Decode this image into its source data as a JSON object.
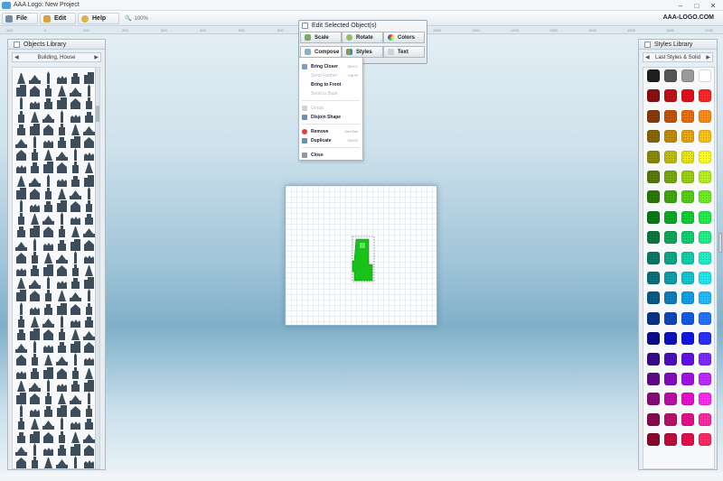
{
  "window": {
    "title": "AAA Logo: New Project"
  },
  "menu": {
    "file_label": "File",
    "edit_label": "Edit",
    "help_label": "Help",
    "zoom_value": "100%",
    "brand": "AAA-LOGO.COM"
  },
  "ruler_ticks": [
    "-100",
    "0",
    "100",
    "200",
    "300",
    "400",
    "500",
    "600",
    "700",
    "800",
    "900",
    "1000",
    "1100",
    "1200",
    "1300",
    "1400",
    "1500",
    "1600",
    "1700"
  ],
  "objects_library": {
    "title": "Objects Library",
    "category": "Building, House",
    "icon_names": [
      "tower-icon",
      "lighthouse-icon",
      "crane-icon",
      "building-icon",
      "factory-icon",
      "house-icon",
      "church-icon",
      "castle-icon",
      "temple-icon",
      "skyscraper-icon",
      "monument-icon",
      "tree-house-icon",
      "barn-icon",
      "bridge-icon",
      "pagoda-icon",
      "pyramid-icon"
    ]
  },
  "edit_panel": {
    "title": "Edit Selected Object(s)",
    "scale_label": "Scale",
    "rotate_label": "Rotate",
    "colors_label": "Colors",
    "compose_label": "Compose",
    "styles_label": "Styles",
    "text_label": "Text"
  },
  "compose_menu": {
    "bring_closer": "Bring Closer",
    "bring_closer_shortcut": "Ctrl+C",
    "send_farther": "Send Farther",
    "send_farther_shortcut": "Ctrl+F",
    "bring_to_front": "Bring to Front",
    "send_to_back": "Send to Back",
    "group": "Group",
    "disjoin_shape": "Disjoin Shape",
    "remove": "Remove",
    "remove_shortcut": "Ctrl+Del",
    "duplicate": "Duplicate",
    "duplicate_shortcut": "Ctrl+D",
    "close": "Close"
  },
  "styles_library": {
    "title": "Styles Library",
    "category": "Last Styles & Solid",
    "swatch_rows": [
      [
        "#1e1e1e",
        "#555555",
        "#9a9a9a",
        "#ffffff"
      ],
      [
        "#8b0f12",
        "#c01018",
        "#e0111a",
        "#ff2626"
      ],
      [
        "#8a3a08",
        "#c0560a",
        "#e8700c",
        "#ff8c1a"
      ],
      [
        "#8a6508",
        "#c08a0a",
        "#e6a80c",
        "#ffc21a"
      ],
      [
        "#8a8a0a",
        "#bdbd0e",
        "#e6e610",
        "#ffff22"
      ],
      [
        "#5a7a0a",
        "#7aa80e",
        "#9ad010",
        "#b8f020"
      ],
      [
        "#2a7a0a",
        "#3ea80e",
        "#54d010",
        "#6ef020"
      ],
      [
        "#0a7a18",
        "#0ea826",
        "#10d034",
        "#22f04a"
      ],
      [
        "#0a7a3e",
        "#0ea858",
        "#10d070",
        "#22f088"
      ],
      [
        "#0a7a62",
        "#0ea888",
        "#10d0aa",
        "#22f0c8"
      ],
      [
        "#0a727a",
        "#0ea0a8",
        "#10c8d0",
        "#22e8f0"
      ],
      [
        "#0a5a8a",
        "#0e7ebd",
        "#10a0e6",
        "#22bcff"
      ],
      [
        "#0a348a",
        "#0e48bd",
        "#105ce6",
        "#2274ff"
      ],
      [
        "#0a0e8a",
        "#0e12bd",
        "#1016e6",
        "#2a30ff"
      ],
      [
        "#360a8a",
        "#4a0ebd",
        "#5e10e6",
        "#7a2aff"
      ],
      [
        "#5e0a8a",
        "#820ebd",
        "#a410e6",
        "#c02aff"
      ],
      [
        "#8a0a7a",
        "#bd0ea8",
        "#e610d0",
        "#ff2af0"
      ],
      [
        "#8a0a4e",
        "#bd0e6c",
        "#e6108a",
        "#ff2aa6"
      ],
      [
        "#8a0a2c",
        "#bd0e3c",
        "#e6104c",
        "#ff2a62"
      ]
    ]
  },
  "colors": {
    "object_fill": "#19c219",
    "panel_bg": "#e7edf1",
    "icon_dark": "#3d4d5c"
  }
}
